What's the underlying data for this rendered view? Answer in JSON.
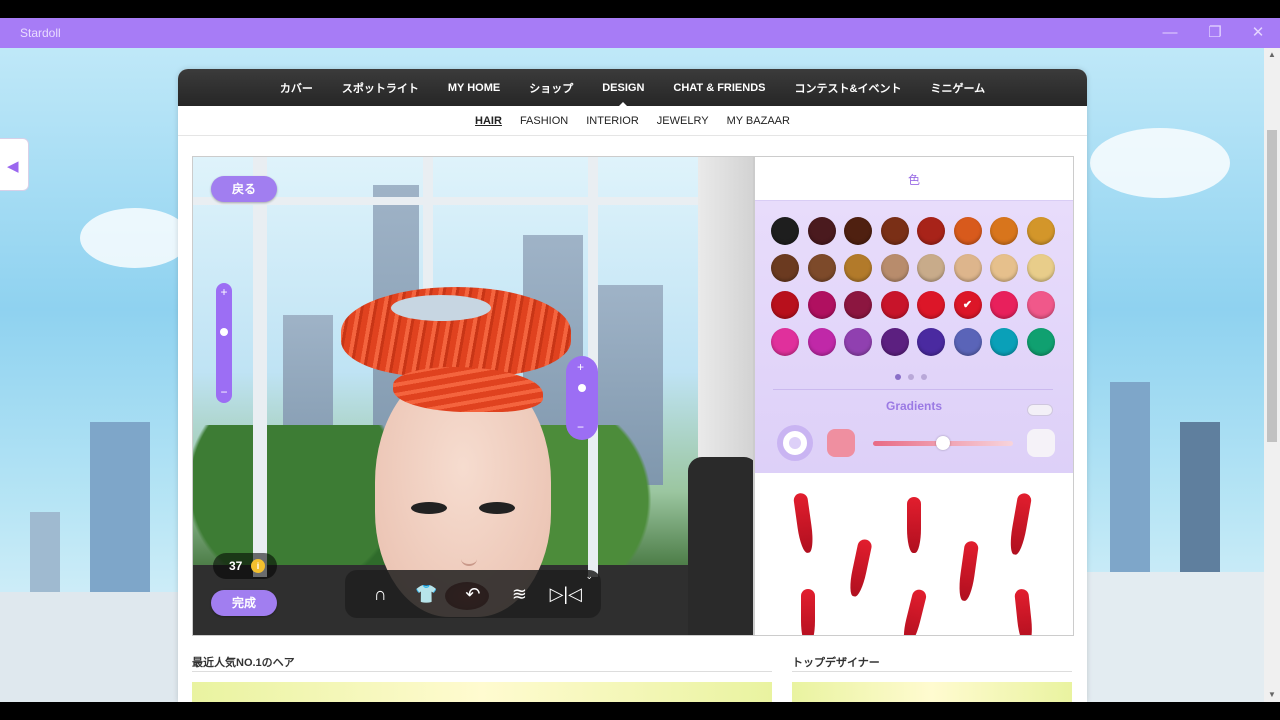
{
  "window": {
    "title": "Stardoll"
  },
  "nav": {
    "items": [
      "カバー",
      "スポットライト",
      "MY HOME",
      "ショップ",
      "DESIGN",
      "CHAT & FRIENDS",
      "コンテスト&イベント",
      "ミニゲーム"
    ],
    "active": "DESIGN"
  },
  "subnav": {
    "items": [
      "HAIR",
      "FASHION",
      "INTERIOR",
      "JEWELRY",
      "MY BAZAAR"
    ],
    "active": "HAIR"
  },
  "stage": {
    "back_label": "戻る",
    "done_label": "完成",
    "coins": "37",
    "coin_icon": "i"
  },
  "panel": {
    "tab_label": "色",
    "gradients_label": "Gradients",
    "gradients_enabled": false,
    "slider_level": 0.5,
    "page_dots": 3,
    "active_page": 1,
    "selected_color": "#dc1628",
    "colors": [
      "#1e1e1e",
      "#4a1a1e",
      "#4f2010",
      "#7a2f16",
      "#a82319",
      "#d85a1c",
      "#d8751c",
      "#d3962a",
      "#6b3a20",
      "#7d4a2a",
      "#b27a2a",
      "#b88c6c",
      "#c8ab8a",
      "#ddb58c",
      "#e6c08c",
      "#e8cd8a",
      "#b8101c",
      "#b01060",
      "#8c1640",
      "#c8142a",
      "#dc1628",
      "#dc1628",
      "#e8205c",
      "#f0588a",
      "#e0309c",
      "#c028a8",
      "#9040b0",
      "#5c2080",
      "#4a2aa0",
      "#5a64b8",
      "#0aa0b8",
      "#10a070"
    ]
  },
  "sections": {
    "popular": "最近人気NO.1のヘア",
    "designers": "トップデザイナー"
  }
}
